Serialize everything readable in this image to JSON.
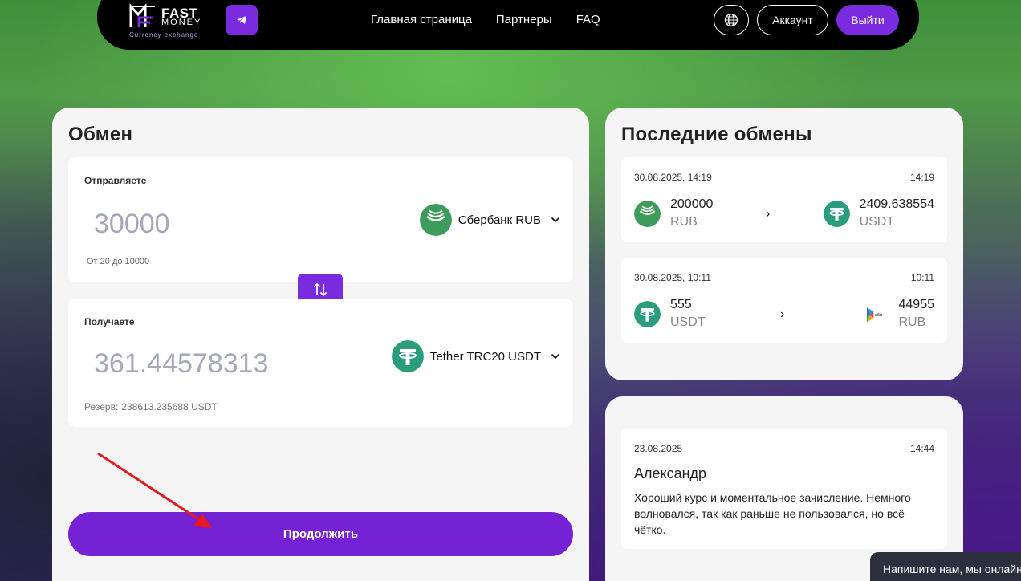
{
  "header": {
    "logo_fast": "FAST",
    "logo_money": "MONEY",
    "logo_sub": "Currency exchange",
    "nav": [
      "Главная страница",
      "Партнеры",
      "FAQ"
    ],
    "account_label": "Аккаунт",
    "logout_label": "Выйти",
    "accent": "#7a2be0"
  },
  "exchange": {
    "title": "Обмен",
    "send": {
      "label": "Отправляете",
      "amount": "30000",
      "currency": "Сбербанк RUB",
      "hint": "От 20 до 10000"
    },
    "receive": {
      "label": "Получаете",
      "amount": "361.44578313",
      "currency": "Tether TRC20 USDT",
      "reserve_label": "Резерв:",
      "reserve_value": "238613.235688 USDT"
    },
    "continue_label": "Продолжить"
  },
  "latest": {
    "title": "Последние обмены",
    "items": [
      {
        "date": "30.08.2025, 14:19",
        "time": "14:19",
        "from_amount": "200000",
        "from_ccy": "RUB",
        "to_amount": "2409.638554",
        "to_ccy": "USDT",
        "from_icon": "sberbank-icon",
        "to_icon": "tether-icon"
      },
      {
        "date": "30.08.2025, 10:11",
        "time": "10:11",
        "from_amount": "555",
        "from_ccy": "USDT",
        "to_amount": "44955",
        "to_ccy": "RUB",
        "from_icon": "tether-icon",
        "to_icon": "sbp-icon"
      }
    ],
    "arrow": "›"
  },
  "review": {
    "date": "23.08.2025",
    "time": "14:44",
    "name": "Александр",
    "text": "Хороший курс и моментальное зачисление. Немного волновался, так как раньше не пользовался, но всё чётко."
  },
  "chat": {
    "text": "Напишите нам, мы онлайн"
  },
  "sbp_label": "сбп"
}
